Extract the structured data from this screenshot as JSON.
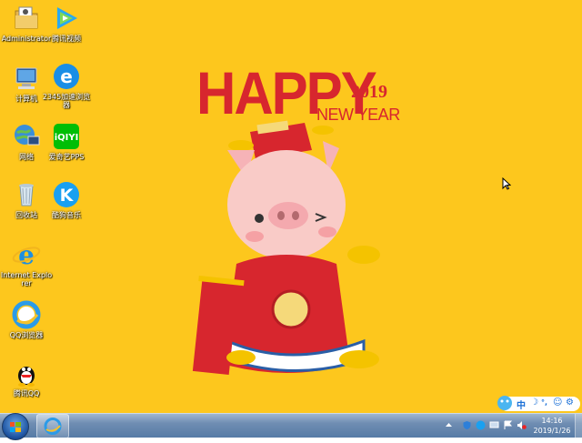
{
  "desktop_icons": [
    {
      "name": "administrator-folder-icon",
      "label": "Administrator"
    },
    {
      "name": "tencent-video-icon",
      "label": "腾讯视频"
    },
    {
      "name": "computer-icon",
      "label": "计算机"
    },
    {
      "name": "browser-2345-icon",
      "label": "2345加速浏览器"
    },
    {
      "name": "network-icon",
      "label": "网络"
    },
    {
      "name": "iqiyi-icon",
      "label": "爱奇艺PPS"
    },
    {
      "name": "recycle-bin-icon",
      "label": "回收站"
    },
    {
      "name": "kugou-music-icon",
      "label": "酷狗音乐"
    },
    {
      "name": "internet-explorer-icon",
      "label": "Internet Explorer"
    },
    {
      "name": "qq-browser-icon",
      "label": "QQ浏览器"
    },
    {
      "name": "tencent-qq-icon",
      "label": "腾讯QQ"
    }
  ],
  "wallpaper": {
    "headline": "HAPPY",
    "year": "2019",
    "subtitle": "NEW YEAR"
  },
  "ime": {
    "mode": "中"
  },
  "clock": {
    "time": "14:16",
    "date": "2019/1/26"
  },
  "colors": {
    "desktop_bg": "#FDC71D",
    "accent_red": "#D7262E"
  }
}
